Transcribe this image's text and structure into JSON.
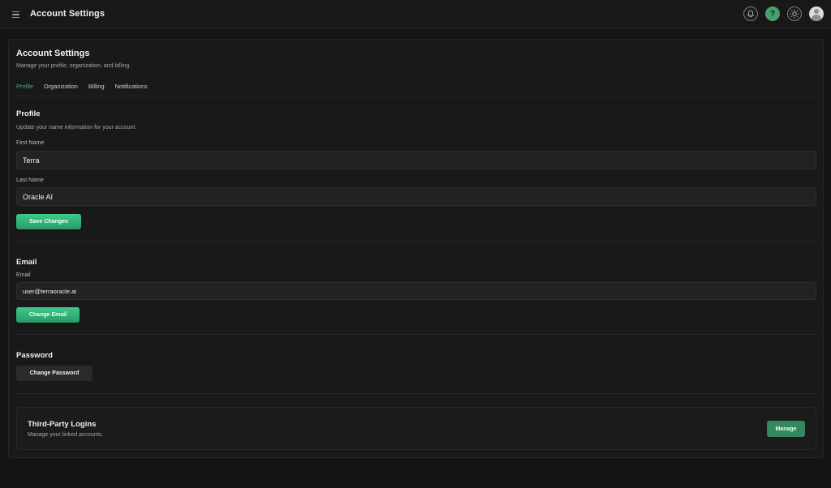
{
  "header": {
    "title": "Account Settings",
    "help_glyph": "?",
    "icons": [
      "menu-icon",
      "bell-icon",
      "help-icon",
      "sun-icon",
      "avatar-icon"
    ]
  },
  "page": {
    "title": "Account Settings",
    "subtitle": "Manage your profile, organization, and billing.",
    "tabs": [
      {
        "label": "Profile",
        "active": true
      },
      {
        "label": "Organization",
        "active": false
      },
      {
        "label": "Billing",
        "active": false
      },
      {
        "label": "Notifications",
        "active": false
      }
    ]
  },
  "profile": {
    "title": "Profile",
    "description": "Update your name information for your account.",
    "first_name_label": "First Name",
    "first_name_value": "Terra",
    "last_name_label": "Last Name",
    "last_name_value": "Oracle AI",
    "save_label": "Save Changes"
  },
  "email": {
    "title": "Email",
    "field_label": "Email",
    "value": "user@terraoracle.ai",
    "change_label": "Change Email"
  },
  "password": {
    "title": "Password",
    "change_label": "Change Password"
  },
  "third_party": {
    "title": "Third-Party Logins",
    "description": "Manage your linked accounts.",
    "manage_label": "Manage"
  },
  "colors": {
    "accent": "#4fae78",
    "button_green": "#3dca8a",
    "background": "#141414"
  }
}
